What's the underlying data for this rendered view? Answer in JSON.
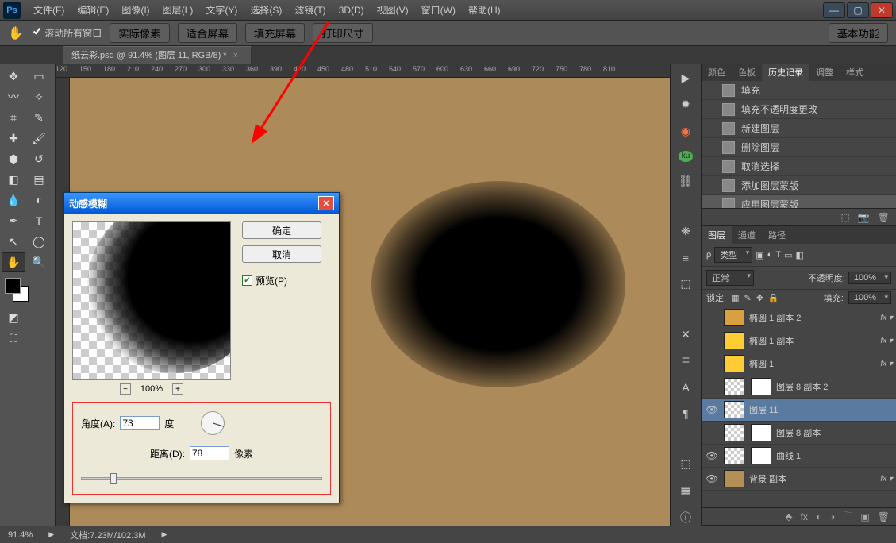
{
  "menu": [
    "文件(F)",
    "编辑(E)",
    "图像(I)",
    "图层(L)",
    "文字(Y)",
    "选择(S)",
    "滤镜(T)",
    "3D(D)",
    "视图(V)",
    "窗口(W)",
    "帮助(H)"
  ],
  "optbar": {
    "scroll_all": "滚动所有窗口",
    "buttons": [
      "实际像素",
      "适合屏幕",
      "填充屏幕",
      "打印尺寸"
    ],
    "mode": "基本功能"
  },
  "doc_tab": "纸云彩.psd @ 91.4% (图层 11, RGB/8) *",
  "ruler_marks": [
    120,
    150,
    180,
    210,
    240,
    270,
    300,
    330,
    360,
    390,
    420,
    450,
    480,
    510,
    540,
    570,
    600,
    630,
    660,
    690,
    720,
    750,
    780,
    810
  ],
  "dialog": {
    "title": "动感模糊",
    "ok": "确定",
    "cancel": "取消",
    "preview": "预览(P)",
    "zoom": "100%",
    "angle_label": "角度(A):",
    "angle_value": "73",
    "angle_unit": "度",
    "dist_label": "距离(D):",
    "dist_value": "78",
    "dist_unit": "像素"
  },
  "history": {
    "tabs": [
      "颜色",
      "色板",
      "历史记录",
      "调整",
      "样式"
    ],
    "items": [
      "填充",
      "填充不透明度更改",
      "新建图层",
      "删除图层",
      "取消选择",
      "添加图层蒙版",
      "应用图层蒙版"
    ]
  },
  "layers": {
    "tabs": [
      "图层",
      "通道",
      "路径"
    ],
    "search": "类型",
    "blend": "正常",
    "opac_label": "不透明度:",
    "opac_val": "100%",
    "lock_label": "锁定:",
    "fill_label": "填充:",
    "fill_val": "100%",
    "rows": [
      {
        "eye": "",
        "t": "shape2",
        "name": "椭圆 1 副本 2",
        "fx": true
      },
      {
        "eye": "",
        "t": "shape",
        "name": "椭圆 1 副本",
        "fx": true
      },
      {
        "eye": "",
        "t": "shape",
        "name": "椭圆 1",
        "fx": true
      },
      {
        "eye": "",
        "t": "chk",
        "mask": true,
        "name": "图层 8 副本 2"
      },
      {
        "eye": "👁",
        "t": "chk",
        "name": "图层 11",
        "sel": true
      },
      {
        "eye": "",
        "t": "chk",
        "mask": true,
        "name": "图层 8 副本"
      },
      {
        "eye": "👁",
        "t": "adj",
        "name": "曲线 1"
      },
      {
        "eye": "👁",
        "t": "bg",
        "name": "背景 副本",
        "fx": true
      }
    ]
  },
  "status": {
    "zoom": "91.4%",
    "doc": "文档:7.23M/102.3M"
  }
}
